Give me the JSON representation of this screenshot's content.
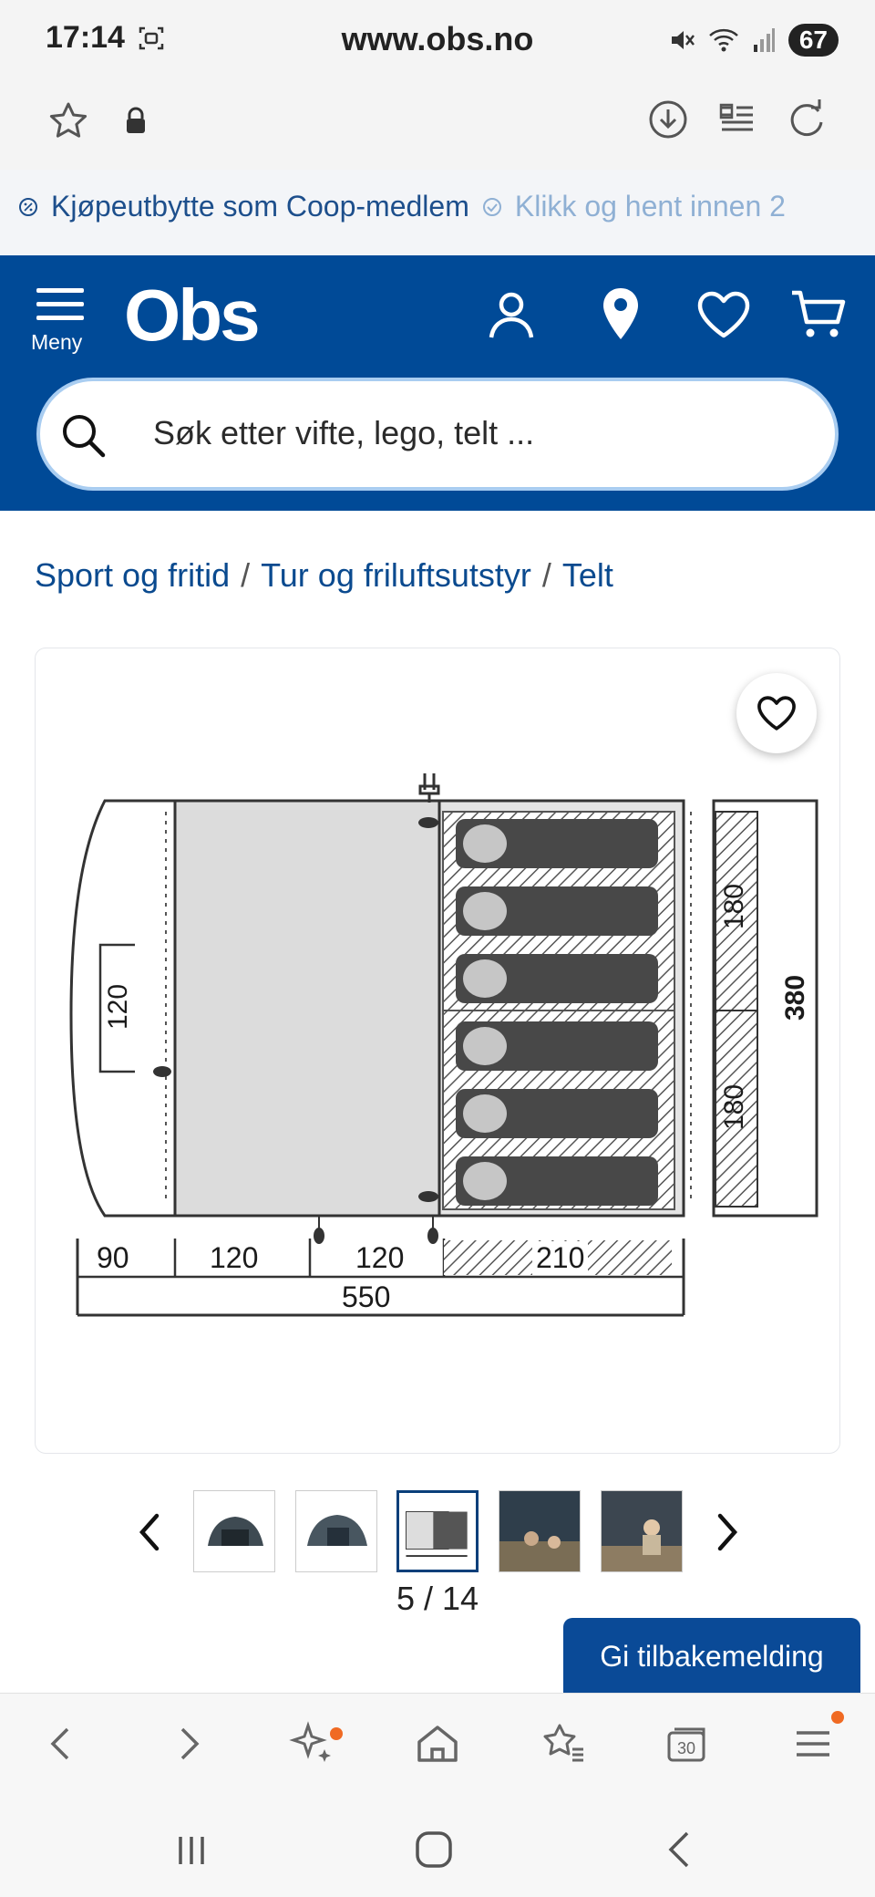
{
  "status_bar": {
    "time": "17:14",
    "battery": "67"
  },
  "url_bar": {
    "url": "www.obs.no"
  },
  "promo": {
    "text_1": "Kjøpeutbytte som Coop-medlem",
    "text_2": "Klikk og hent innen 2"
  },
  "header": {
    "menu_label": "Meny",
    "logo_text": "Obs",
    "search_placeholder": "Søk etter vifte, lego, telt ..."
  },
  "breadcrumb": {
    "items": [
      "Sport og fritid",
      "Tur og friluftsutstyr",
      "Telt"
    ],
    "separator": "/"
  },
  "floorplan": {
    "dim_120_door": "120",
    "dim_180_top": "180",
    "dim_180_bottom": "180",
    "dim_380": "380",
    "dim_90": "90",
    "dim_120_a": "120",
    "dim_120_b": "120",
    "dim_210": "210",
    "dim_550": "550"
  },
  "carousel": {
    "counter": "5 / 14",
    "current": 5,
    "total": 14,
    "thumbnail_count": 5
  },
  "feedback": {
    "label": "Gi tilbakemelding"
  },
  "colors": {
    "brand_blue": "#004a97",
    "link_blue": "#0a4a8f",
    "notification_dot": "#f06a23"
  }
}
